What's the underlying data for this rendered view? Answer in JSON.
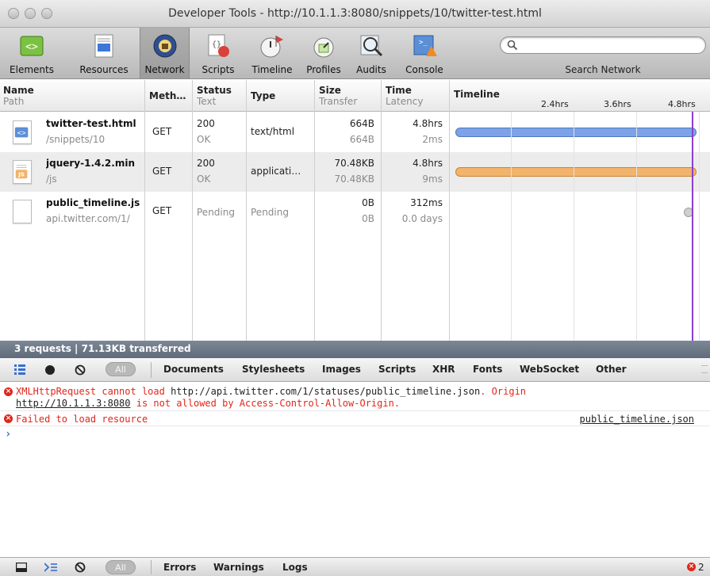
{
  "window": {
    "title": "Developer Tools - http://10.1.1.3:8080/snippets/10/twitter-test.html"
  },
  "toolbar": {
    "items": [
      {
        "label": "Elements",
        "icon": "elements-icon"
      },
      {
        "label": "Resources",
        "icon": "resources-icon"
      },
      {
        "label": "Network",
        "icon": "network-icon",
        "selected": true
      },
      {
        "label": "Scripts",
        "icon": "scripts-icon"
      },
      {
        "label": "Timeline",
        "icon": "timeline-icon"
      },
      {
        "label": "Profiles",
        "icon": "profiles-icon"
      },
      {
        "label": "Audits",
        "icon": "audits-icon"
      },
      {
        "label": "Console",
        "icon": "console-icon"
      }
    ],
    "search_label": "Search Network",
    "search_value": ""
  },
  "network": {
    "headers": {
      "name": "Name",
      "path": "Path",
      "method": "Meth…",
      "status": "Status",
      "text": "Text",
      "type": "Type",
      "size": "Size",
      "transfer": "Transfer",
      "time": "Time",
      "latency": "Latency",
      "timeline": "Timeline"
    },
    "timeline_ticks": [
      "2.4hrs",
      "3.6hrs",
      "4.8hrs"
    ],
    "rows": [
      {
        "name": "twitter-test.html",
        "path": "/snippets/10",
        "method": "GET",
        "status": "200",
        "status_text": "OK",
        "type": "text/html",
        "size": "664B",
        "transfer": "664B",
        "time": "4.8hrs",
        "latency": "2ms",
        "icon": "html-file-icon",
        "bar_color": "#7da3e6"
      },
      {
        "name": "jquery-1.4.2.min",
        "path": "/js",
        "method": "GET",
        "status": "200",
        "status_text": "OK",
        "type": "applicati…",
        "size": "70.48KB",
        "transfer": "70.48KB",
        "time": "4.8hrs",
        "latency": "9ms",
        "icon": "js-file-icon",
        "bar_color": "#f2b36a"
      },
      {
        "name": "public_timeline.js",
        "path": "api.twitter.com/1/",
        "method": "GET",
        "status": "Pending",
        "status_text": "",
        "type": "Pending",
        "size": "0B",
        "transfer": "0B",
        "time": "312ms",
        "latency": "0.0 days",
        "icon": "blank-file-icon",
        "bar_color": "#cccccc"
      }
    ],
    "summary": "3 requests  |  71.13KB transferred"
  },
  "filters": {
    "all_label": "All",
    "items": [
      "Documents",
      "Stylesheets",
      "Images",
      "Scripts",
      "XHR",
      "Fonts",
      "WebSocket",
      "Other"
    ]
  },
  "console": {
    "messages": [
      {
        "type": "error",
        "text_a": "XMLHttpRequest cannot load ",
        "url1": "http://api.twitter.com/1/statuses/public_timeline.json",
        "text_b": ". Origin",
        "url2": "http://10.1.1.3:8080",
        "text_c": " is not allowed by Access-Control-Allow-Origin."
      },
      {
        "type": "error",
        "text": "Failed to load resource",
        "source": "public_timeline.json"
      }
    ],
    "prompt": "›"
  },
  "statusbar": {
    "all_label": "All",
    "items": [
      "Errors",
      "Warnings",
      "Logs"
    ],
    "error_count": "2"
  },
  "colors": {
    "accent": "#8a3fd1",
    "error": "#e0261b",
    "summary_bg": "#6d7888"
  }
}
